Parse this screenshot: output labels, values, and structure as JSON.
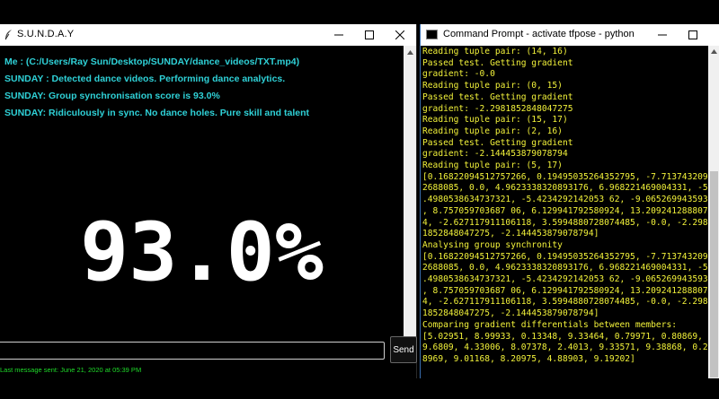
{
  "left_window": {
    "title": "S.U.N.D.A.Y",
    "chat_lines": [
      "Me : (C:/Users/Ray Sun/Desktop/SUNDAY/dance_videos/TXT.mp4)",
      "SUNDAY : Detected dance videos. Performing dance analytics.",
      "SUNDAY: Group synchronisation score is 93.0%",
      "SUNDAY: Ridiculously in sync. No dance holes. Pure skill and talent"
    ],
    "score_display": "93.0%",
    "input_value": "",
    "send_label": "Send",
    "last_message": "Last message sent: June 21, 2020 at 05:39 PM"
  },
  "right_window": {
    "title": "Command Prompt - activate  tfpose - python ...",
    "console_lines": [
      "Reading tuple pair: (14, 16)",
      "Passed test. Getting gradient",
      "gradient: -0.0",
      "Reading tuple pair: (0, 15)",
      "Passed test. Getting gradient",
      "gradient: -2.2981852848047275",
      "Reading tuple pair: (15, 17)",
      "Reading tuple pair: (2, 16)",
      "Passed test. Getting gradient",
      "gradient: -2.144453879078794",
      "Reading tuple pair: (5, 17)",
      "[0.16822094512757266, 0.19495035264352795, -7.7137432092",
      "2688085, 0.0, 4.9623338320893176, 6.968221469004331, -5",
      ".4980538634737321, -5.4234292142053 62, -9.065269943593898",
      ", 8.757059703687 06, 6.129941792580924, 13.2092412888075",
      "4, -2.627117911106118, 3.5994880728074485, -0.0, -2.298",
      "1852848047275, -2.144453879078794]",
      "Analysing group synchronity",
      "[0.16822094512757266, 0.19495035264352795, -7.7137432092",
      "2688085, 0.0, 4.9623338320893176, 6.968221469004331, -5",
      ".4980538634737321, -5.4234292142053 62, -9.065269943593898",
      ", 8.757059703687 06, 6.129941792580924, 13.2092412888075",
      "4, -2.627117911106118, 3.5994880728074485, -0.0, -2.298",
      "1852848047275, -2.144453879078794]",
      "Comparing gradient differentials between members:",
      "[5.02951, 8.99933, 0.13348, 9.33464, 0.79971, 0.80869,",
      "9.6809, 4.33006, 8.07378, 2.4013, 9.33571, 9.38868, 0.2",
      "8969, 9.01168, 8.20975, 4.88903, 9.19202]"
    ]
  },
  "colors": {
    "chat_text": "#2fd1d7",
    "console_text": "#f2f23a",
    "last_message_text": "#1fdb2a",
    "score_text": "#ffffff",
    "background": "#000000"
  },
  "icons": [
    "feather-icon",
    "minimize-icon",
    "maximize-icon",
    "close-icon",
    "cmd-icon",
    "scroll-up-arrow-icon",
    "scroll-down-arrow-icon"
  ]
}
